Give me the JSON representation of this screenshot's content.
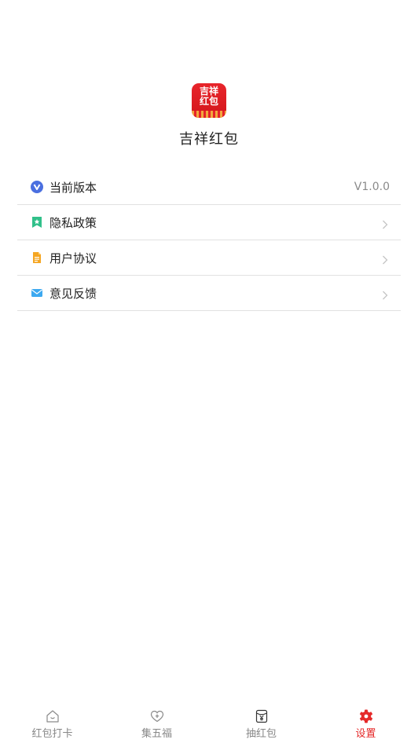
{
  "app": {
    "name": "吉祥红包",
    "logo_text": "吉祥\n红包"
  },
  "menu": {
    "items": [
      {
        "label": "当前版本",
        "value": "V1.0.0",
        "icon": "v-badge-icon"
      },
      {
        "label": "隐私政策",
        "icon": "bookmark-icon"
      },
      {
        "label": "用户协议",
        "icon": "document-icon"
      },
      {
        "label": "意见反馈",
        "icon": "mail-icon"
      }
    ]
  },
  "tabbar": {
    "tabs": [
      {
        "label": "红包打卡",
        "icon": "home-icon",
        "active": false
      },
      {
        "label": "集五福",
        "icon": "heart-plus-icon",
        "active": false
      },
      {
        "label": "抽红包",
        "icon": "red-envelope-icon",
        "active": false
      },
      {
        "label": "设置",
        "icon": "gear-icon",
        "active": true
      }
    ]
  },
  "colors": {
    "accent": "#e52929",
    "divider": "#e1e1e1",
    "inactive_tab": "#888888"
  }
}
